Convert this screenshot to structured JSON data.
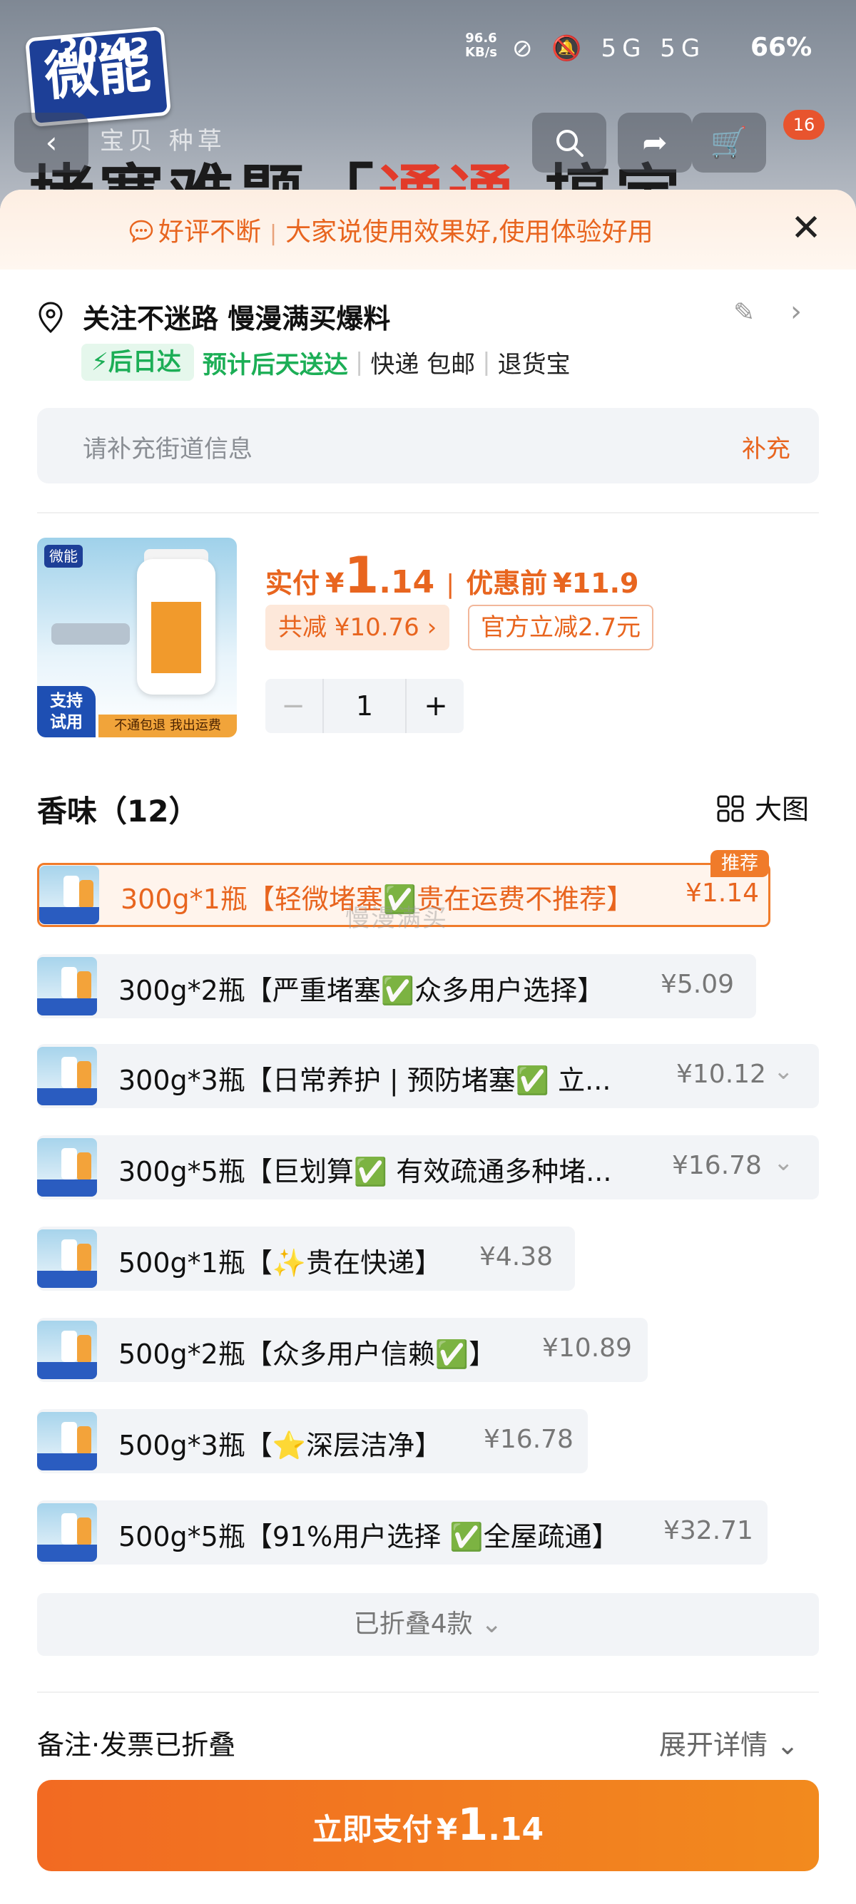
{
  "status": {
    "time": "20:42",
    "speed_value": "96.6",
    "speed_unit": "KB/s",
    "icons": "⊘ 🔕 5G 5G",
    "battery": "66%"
  },
  "background": {
    "brand_logo": "微能",
    "tabs": "宝贝 种草",
    "headline_start": "堵塞难题「",
    "headline_red": "通通",
    "headline_end": "搞定",
    "cart_count": "16"
  },
  "banner": {
    "left": "好评不断",
    "right": "大家说使用效果好,使用体验好用"
  },
  "address": {
    "name": "关注不迷路 慢漫满买爆料",
    "badge": "后日达",
    "eta": "预计后天送达",
    "shipping": "快递 包邮",
    "returns": "退货宝",
    "street_placeholder": "请补充街道信息",
    "street_action": "补充"
  },
  "product": {
    "image_badge_top": "支持",
    "image_badge_bottom": "试用",
    "image_strip": "不通包退 我出运费",
    "price_label": "实付",
    "currency": "¥",
    "price_int": "1",
    "price_dec": ".14",
    "orig_label": "优惠前",
    "orig_price": "¥11.9",
    "discount_total": "共减 ¥10.76 ›",
    "discount_official": "官方立减2.7元",
    "quantity": "1"
  },
  "variants": {
    "title": "香味（12）",
    "bigview_label": "大图",
    "recommend_tag": "推荐",
    "watermark": "慢漫满买",
    "items": [
      {
        "label": "300g*1瓶【轻微堵塞✅贵在运费不推荐】",
        "price": "¥1.14"
      },
      {
        "label": "300g*2瓶【严重堵塞✅众多用户选择】",
        "price": "¥5.09"
      },
      {
        "label": "300g*3瓶【日常养护 | 预防堵塞✅ 立...",
        "price": "¥10.12"
      },
      {
        "label": "300g*5瓶【巨划算✅ 有效疏通多种堵...",
        "price": "¥16.78"
      },
      {
        "label": "500g*1瓶【✨贵在快递】",
        "price": "¥4.38"
      },
      {
        "label": "500g*2瓶【众多用户信赖✅】",
        "price": "¥10.89"
      },
      {
        "label": "500g*3瓶【⭐深层洁净】",
        "price": "¥16.78"
      },
      {
        "label": "500g*5瓶【91%用户选择 ✅全屋疏通】",
        "price": "¥32.71"
      }
    ],
    "folded_label": "已折叠4款"
  },
  "footer": {
    "notes_label": "备注·发票已折叠",
    "expand_label": "展开详情",
    "pay_label": "立即支付",
    "pay_currency": "¥",
    "pay_int": "1",
    "pay_dec": ".14"
  },
  "colors": {
    "accent": "#f07b2a",
    "green": "#1cae56"
  }
}
